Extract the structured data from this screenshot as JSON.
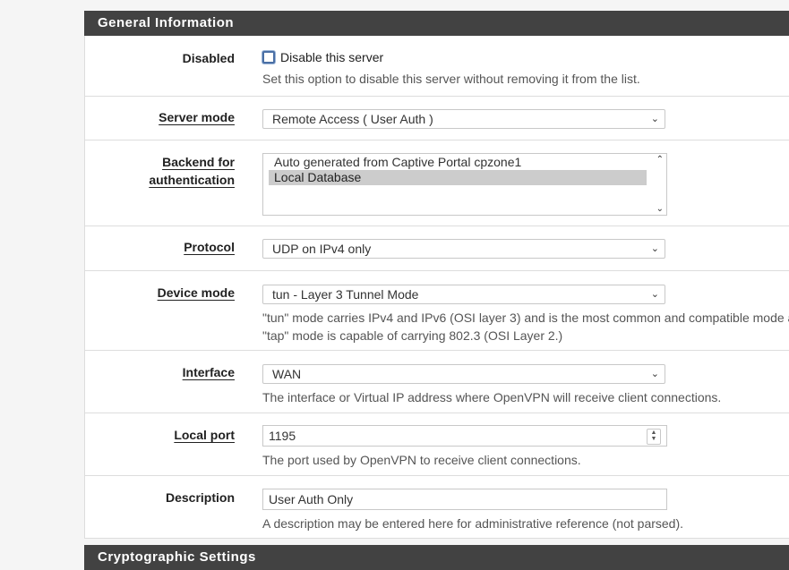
{
  "general": {
    "section_title": "General Information",
    "disabled": {
      "label": "Disabled",
      "checkbox_text": "Disable this server",
      "help": "Set this option to disable this server without removing it from the list."
    },
    "server_mode": {
      "label": "Server mode",
      "value": "Remote Access ( User Auth )"
    },
    "backend": {
      "label_line1": "Backend for",
      "label_line2": "authentication",
      "options": [
        "Auto generated from Captive Portal cpzone1",
        "Local Database"
      ],
      "selected": "Local Database"
    },
    "protocol": {
      "label": "Protocol",
      "value": "UDP on IPv4 only"
    },
    "device_mode": {
      "label": "Device mode",
      "value": "tun - Layer 3 Tunnel Mode",
      "help_line1": "\"tun\" mode carries IPv4 and IPv6 (OSI layer 3) and is the most common and compatible mode a",
      "help_line2": "\"tap\" mode is capable of carrying 802.3 (OSI Layer 2.)"
    },
    "interface": {
      "label": "Interface",
      "value": "WAN",
      "help": "The interface or Virtual IP address where OpenVPN will receive client connections."
    },
    "local_port": {
      "label": "Local port",
      "value": "1195",
      "help": "The port used by OpenVPN to receive client connections."
    },
    "description": {
      "label": "Description",
      "value": "User Auth Only",
      "help": "A description may be entered here for administrative reference (not parsed)."
    }
  },
  "crypto": {
    "section_title": "Cryptographic Settings"
  }
}
